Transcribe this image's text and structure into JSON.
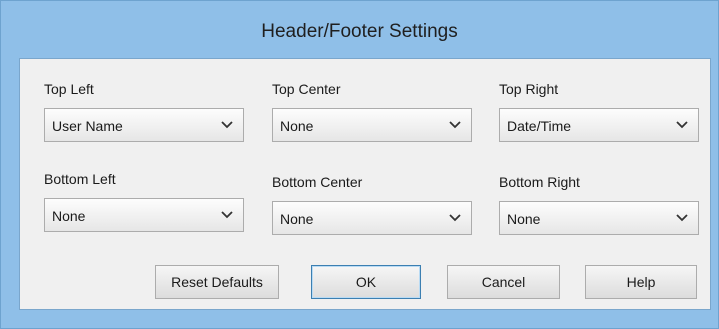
{
  "dialog": {
    "title": "Header/Footer Settings"
  },
  "fields": {
    "top_left": {
      "label": "Top Left",
      "value": "User Name"
    },
    "top_center": {
      "label": "Top Center",
      "value": "None"
    },
    "top_right": {
      "label": "Top Right",
      "value": "Date/Time"
    },
    "bottom_left": {
      "label": "Bottom Left",
      "value": "None"
    },
    "bottom_center": {
      "label": "Bottom Center",
      "value": "None"
    },
    "bottom_right": {
      "label": "Bottom Right",
      "value": "None"
    }
  },
  "buttons": {
    "reset": "Reset Defaults",
    "ok": "OK",
    "cancel": "Cancel",
    "help": "Help"
  },
  "icons": {
    "dropdown": "chevron-down-icon"
  },
  "colors": {
    "frame": "#8fbfe8",
    "client": "#f0f0f0",
    "default_button_border": "#3c7fb1"
  }
}
